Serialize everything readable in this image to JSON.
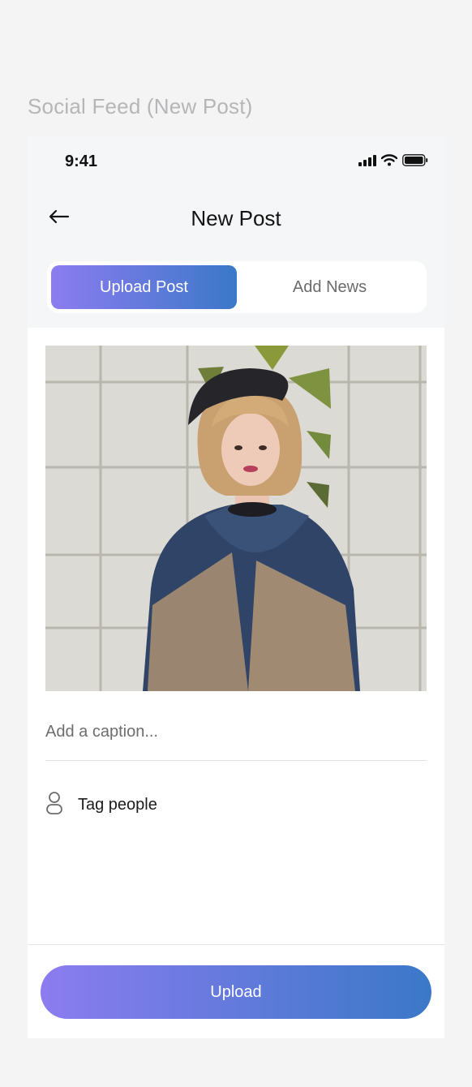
{
  "frame_title": "Social Feed (New Post)",
  "status_bar": {
    "time": "9:41",
    "icons": [
      "signal-icon",
      "wifi-icon",
      "battery-icon"
    ]
  },
  "header": {
    "title": "New Post",
    "back_icon": "arrow-left-icon"
  },
  "tabs": [
    {
      "label": "Upload Post",
      "active": true
    },
    {
      "label": "Add News",
      "active": false
    }
  ],
  "post": {
    "image_alt": "woman in blue and tan oversized top in front of white block wall",
    "caption_placeholder": "Add a caption...",
    "caption_value": "",
    "tag_label": "Tag people",
    "tag_icon": "person-icon"
  },
  "footer": {
    "upload_label": "Upload"
  },
  "colors": {
    "accent_start": "#8c7cf0",
    "accent_end": "#3b78c8",
    "background": "#f4f4f5",
    "surface": "#ffffff"
  }
}
